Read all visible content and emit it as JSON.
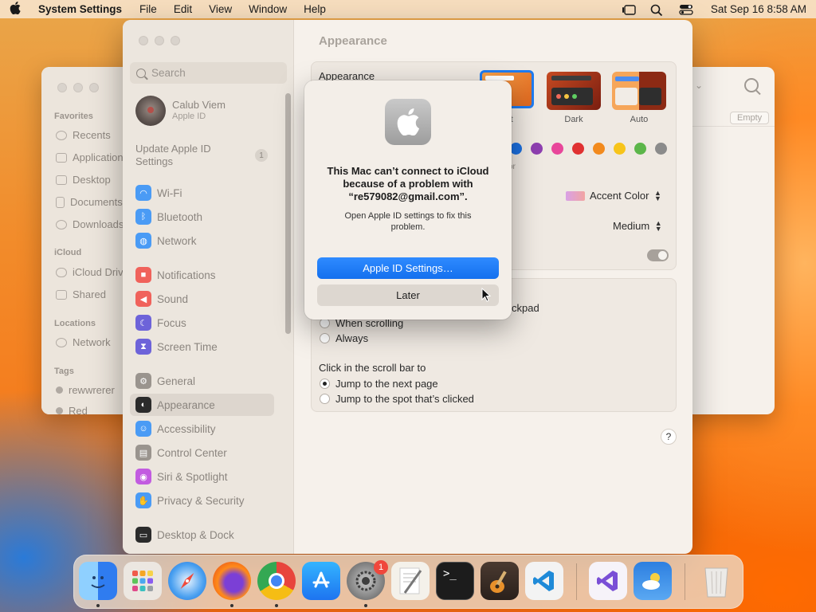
{
  "menubar": {
    "app_name": "System Settings",
    "menus": [
      "File",
      "Edit",
      "View",
      "Window",
      "Help"
    ],
    "clock": "Sat Sep 16  8:58 AM"
  },
  "finder": {
    "sections": {
      "favorites": "Favorites",
      "icloud": "iCloud",
      "locations": "Locations",
      "tags": "Tags"
    },
    "favorites": [
      "Recents",
      "Applications",
      "Desktop",
      "Documents",
      "Downloads"
    ],
    "icloud_items": [
      "iCloud Drive",
      "Shared"
    ],
    "locations_items": [
      "Network"
    ],
    "tags_items": [
      "rewwrerer",
      "Red"
    ],
    "empty_label": "Empty"
  },
  "settings": {
    "search_placeholder": "Search",
    "account": {
      "name": "Calub Viem",
      "subtitle": "Apple ID"
    },
    "update": {
      "label": "Update Apple ID Settings",
      "badge": "1"
    },
    "sidebar_items": [
      {
        "label": "Wi-Fi",
        "color": "#4a9bf5",
        "glyph": "◠"
      },
      {
        "label": "Bluetooth",
        "color": "#4a9bf5",
        "glyph": "ᛒ"
      },
      {
        "label": "Network",
        "color": "#4a9bf5",
        "glyph": "◍"
      },
      {
        "label": "Notifications",
        "color": "#f0625b",
        "glyph": "■"
      },
      {
        "label": "Sound",
        "color": "#f0625b",
        "glyph": "◀"
      },
      {
        "label": "Focus",
        "color": "#6d63d9",
        "glyph": "☾"
      },
      {
        "label": "Screen Time",
        "color": "#6d63d9",
        "glyph": "⧗"
      },
      {
        "label": "General",
        "color": "#9a948e",
        "glyph": "⚙"
      },
      {
        "label": "Appearance",
        "color": "#2b2b2b",
        "glyph": "◐"
      },
      {
        "label": "Accessibility",
        "color": "#4a9bf5",
        "glyph": "☺"
      },
      {
        "label": "Control Center",
        "color": "#9a948e",
        "glyph": "▤"
      },
      {
        "label": "Siri & Spotlight",
        "color": "#c25be0",
        "glyph": "◉"
      },
      {
        "label": "Privacy & Security",
        "color": "#4a9bf5",
        "glyph": "✋"
      },
      {
        "label": "Desktop & Dock",
        "color": "#2b2b2b",
        "glyph": "▭"
      }
    ],
    "title": "Appearance",
    "appearance_label": "Appearance",
    "modes": [
      "ght",
      "Dark",
      "Auto"
    ],
    "accent_colors": [
      "#1b6fe0",
      "#8e3fb0",
      "#e8469a",
      "#e03131",
      "#f28a1d",
      "#f7c41a",
      "#5cb64a",
      "#8b8b8b"
    ],
    "accent_hint": "or",
    "accent_color_label": "Accent Color",
    "sidebar_icon_size": "Medium",
    "scroll_bars_partial": "ckpad",
    "scroll_options": [
      "When scrolling",
      "Always"
    ],
    "click_label": "Click in the scroll bar to",
    "click_options": [
      "Jump to the next page",
      "Jump to the spot that’s clicked"
    ],
    "help": "?"
  },
  "alert": {
    "title": "This Mac can’t connect to iCloud because of a problem with “re579082@gmail.com”.",
    "message": "Open Apple ID settings to fix this problem.",
    "primary_button": "Apple ID Settings…",
    "secondary_button": "Later"
  },
  "dock": {
    "badge": "1",
    "apps": [
      {
        "name": "finder-icon",
        "color": "#3d8ef5"
      },
      {
        "name": "launchpad-icon",
        "color": "#e9e4de"
      },
      {
        "name": "safari-icon",
        "color": "#2f8cf0"
      },
      {
        "name": "firefox-icon",
        "color": "#ff7a1a"
      },
      {
        "name": "chrome-icon",
        "color": "#f5f5f5"
      },
      {
        "name": "app-store-icon",
        "color": "#2b8cf5"
      },
      {
        "name": "system-settings-icon",
        "color": "#8a8a8a"
      },
      {
        "name": "textedit-icon",
        "color": "#f4f2ec"
      },
      {
        "name": "terminal-icon",
        "color": "#1c1c1c"
      },
      {
        "name": "garageband-icon",
        "color": "#3a2f2a"
      },
      {
        "name": "vscode-icon",
        "color": "#f3f3f3"
      },
      {
        "name": "visual-studio-icon",
        "color": "#f6f3f9"
      },
      {
        "name": "weather-icon",
        "color": "#3a8be8"
      },
      {
        "name": "trash-icon",
        "color": "#e6e2dd"
      }
    ]
  }
}
